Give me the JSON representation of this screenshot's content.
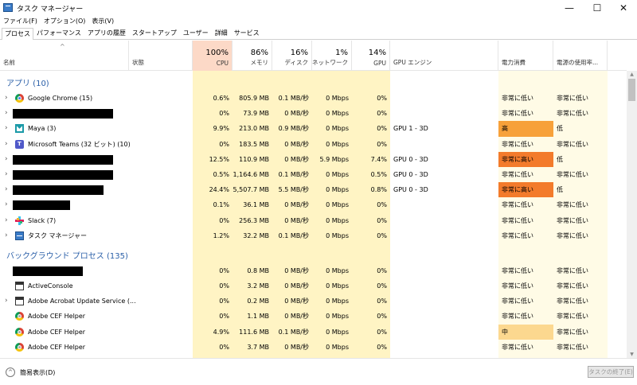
{
  "window": {
    "title": "タスク マネージャー",
    "min_glyph": "—",
    "max_glyph": "☐",
    "close_glyph": "✕"
  },
  "menu": [
    "ファイル(F)",
    "オプション(O)",
    "表示(V)"
  ],
  "tabs": [
    "プロセス",
    "パフォーマンス",
    "アプリの履歴",
    "スタートアップ",
    "ユーザー",
    "詳細",
    "サービス"
  ],
  "header": {
    "sort_glyph": "^",
    "name": "名前",
    "status": "状態",
    "cpu_pct": "100%",
    "cpu": "CPU",
    "mem_pct": "86%",
    "mem": "メモリ",
    "disk_pct": "16%",
    "disk": "ディスク",
    "net_pct": "1%",
    "net": "ネットワーク",
    "gpu_pct": "14%",
    "gpu": "GPU",
    "gpu_engine": "GPU エンジン",
    "power": "電力消費",
    "power_trend": "電源の使用率..."
  },
  "groups": {
    "apps": "アプリ (10)",
    "background": "バックグラウンド プロセス (135)"
  },
  "apps": [
    {
      "name": "Google Chrome (15)",
      "icon": "chrome-icon",
      "expand": true,
      "cpu": "0.6%",
      "mem": "805.9 MB",
      "disk": "0.1 MB/秒",
      "net": "0 Mbps",
      "gpu": "0%",
      "engine": "",
      "power": "非常に低い",
      "trend": "非常に低い",
      "pcolor": ""
    },
    {
      "name": "",
      "redact": 126,
      "expand": true,
      "cpu": "0%",
      "mem": "73.9 MB",
      "disk": "0 MB/秒",
      "net": "0 Mbps",
      "gpu": "0%",
      "engine": "",
      "power": "非常に低い",
      "trend": "非常に低い",
      "pcolor": ""
    },
    {
      "name": "Maya (3)",
      "icon": "maya-icon",
      "expand": true,
      "cpu": "9.9%",
      "mem": "213.0 MB",
      "disk": "0.9 MB/秒",
      "net": "0 Mbps",
      "gpu": "0%",
      "engine": "GPU 1 - 3D",
      "power": "高",
      "trend": "低",
      "pcolor": "#f7a13a"
    },
    {
      "name": "Microsoft Teams (32 ビット) (10)",
      "icon": "teams-icon",
      "expand": true,
      "cpu": "0%",
      "mem": "183.5 MB",
      "disk": "0 MB/秒",
      "net": "0 Mbps",
      "gpu": "0%",
      "engine": "",
      "power": "非常に低い",
      "trend": "非常に低い",
      "pcolor": ""
    },
    {
      "name": "",
      "redact": 126,
      "expand": true,
      "cpu": "12.5%",
      "mem": "110.9 MB",
      "disk": "0 MB/秒",
      "net": "5.9 Mbps",
      "gpu": "7.4%",
      "engine": "GPU 0 - 3D",
      "power": "非常に高い",
      "trend": "低",
      "pcolor": "#f37b2b"
    },
    {
      "name": "",
      "redact": 126,
      "expand": true,
      "cpu": "0.5%",
      "mem": "1,164.6 MB",
      "disk": "0.1 MB/秒",
      "net": "0 Mbps",
      "gpu": "0.5%",
      "engine": "GPU 0 - 3D",
      "power": "非常に低い",
      "trend": "非常に低い",
      "pcolor": ""
    },
    {
      "name": "",
      "redact": 114,
      "expand": true,
      "cpu": "24.4%",
      "mem": "5,507.7 MB",
      "disk": "5.5 MB/秒",
      "net": "0 Mbps",
      "gpu": "0.8%",
      "engine": "GPU 0 - 3D",
      "power": "非常に高い",
      "trend": "低",
      "pcolor": "#f37b2b"
    },
    {
      "name": "",
      "redact": 72,
      "expand": true,
      "cpu": "0.1%",
      "mem": "36.1 MB",
      "disk": "0 MB/秒",
      "net": "0 Mbps",
      "gpu": "0%",
      "engine": "",
      "power": "非常に低い",
      "trend": "非常に低い",
      "pcolor": ""
    },
    {
      "name": "Slack (7)",
      "icon": "slack-icon",
      "expand": true,
      "cpu": "0%",
      "mem": "256.3 MB",
      "disk": "0 MB/秒",
      "net": "0 Mbps",
      "gpu": "0%",
      "engine": "",
      "power": "非常に低い",
      "trend": "非常に低い",
      "pcolor": ""
    },
    {
      "name": "タスク マネージャー",
      "icon": "task-manager-icon",
      "expand": true,
      "cpu": "1.2%",
      "mem": "32.2 MB",
      "disk": "0.1 MB/秒",
      "net": "0 Mbps",
      "gpu": "0%",
      "engine": "",
      "power": "非常に低い",
      "trend": "非常に低い",
      "pcolor": ""
    }
  ],
  "background": [
    {
      "name": "",
      "redact": 88,
      "expand": false,
      "cpu": "0%",
      "mem": "0.8 MB",
      "disk": "0 MB/秒",
      "net": "0 Mbps",
      "gpu": "0%",
      "engine": "",
      "power": "非常に低い",
      "trend": "非常に低い",
      "pcolor": ""
    },
    {
      "name": "ActiveConsole",
      "icon": "window-icon",
      "expand": false,
      "cpu": "0%",
      "mem": "3.2 MB",
      "disk": "0 MB/秒",
      "net": "0 Mbps",
      "gpu": "0%",
      "engine": "",
      "power": "非常に低い",
      "trend": "非常に低い",
      "pcolor": ""
    },
    {
      "name": "Adobe Acrobat Update Service (...",
      "icon": "window-icon",
      "expand": true,
      "cpu": "0%",
      "mem": "0.2 MB",
      "disk": "0 MB/秒",
      "net": "0 Mbps",
      "gpu": "0%",
      "engine": "",
      "power": "非常に低い",
      "trend": "非常に低い",
      "pcolor": ""
    },
    {
      "name": "Adobe CEF Helper",
      "icon": "adobe-cef-icon",
      "expand": false,
      "cpu": "0%",
      "mem": "1.1 MB",
      "disk": "0 MB/秒",
      "net": "0 Mbps",
      "gpu": "0%",
      "engine": "",
      "power": "非常に低い",
      "trend": "非常に低い",
      "pcolor": ""
    },
    {
      "name": "Adobe CEF Helper",
      "icon": "adobe-cef-icon",
      "expand": false,
      "cpu": "4.9%",
      "mem": "111.6 MB",
      "disk": "0.1 MB/秒",
      "net": "0 Mbps",
      "gpu": "0%",
      "engine": "",
      "power": "中",
      "trend": "非常に低い",
      "pcolor": "#fcd88f"
    },
    {
      "name": "Adobe CEF Helper",
      "icon": "adobe-cef-icon",
      "expand": false,
      "cpu": "0%",
      "mem": "3.7 MB",
      "disk": "0 MB/秒",
      "net": "0 Mbps",
      "gpu": "0%",
      "engine": "",
      "power": "非常に低い",
      "trend": "非常に低い",
      "pcolor": ""
    }
  ],
  "footer": {
    "fewer_details": "簡易表示(D)",
    "end_task": "タスクの終了(E)"
  },
  "colors": {
    "cpu_bg": "#fcd9c7",
    "yellow_bg": "#fff4c4",
    "yellow_light": "#fffbe6",
    "group_text": "#2a5fa8"
  }
}
